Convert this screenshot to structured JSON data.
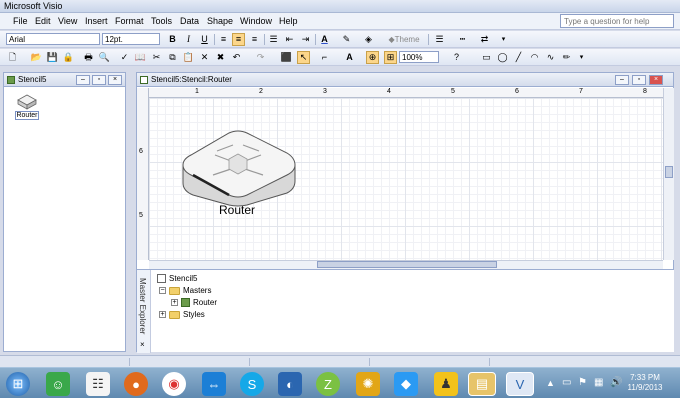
{
  "window": {
    "title": "Microsoft Visio"
  },
  "menu": [
    "File",
    "Edit",
    "View",
    "Insert",
    "Format",
    "Tools",
    "Data",
    "Shape",
    "Window",
    "Help"
  ],
  "help_placeholder": "Type a question for help",
  "format_bar": {
    "font": "Arial",
    "size": "12pt.",
    "theme_label": "Theme"
  },
  "standard_bar": {
    "zoom": "100%"
  },
  "stencil": {
    "title": "Stencil5",
    "master_label": "Router"
  },
  "drawing": {
    "title": "Stencil5:Stencil:Router",
    "shape_label": "Router",
    "ruler_top": [
      "1",
      "2",
      "3",
      "4",
      "5",
      "6",
      "7",
      "8"
    ],
    "ruler_left": [
      "6",
      "5"
    ]
  },
  "explorer": {
    "side_label": "Master Explorer",
    "root": "Stencil5",
    "masters": "Masters",
    "item": "Router",
    "styles": "Styles"
  },
  "clock": {
    "time": "7:33 PM",
    "date": "11/9/2013"
  },
  "colors": {
    "accent": "#fcd68a",
    "taskbar": "#5f89b0"
  }
}
